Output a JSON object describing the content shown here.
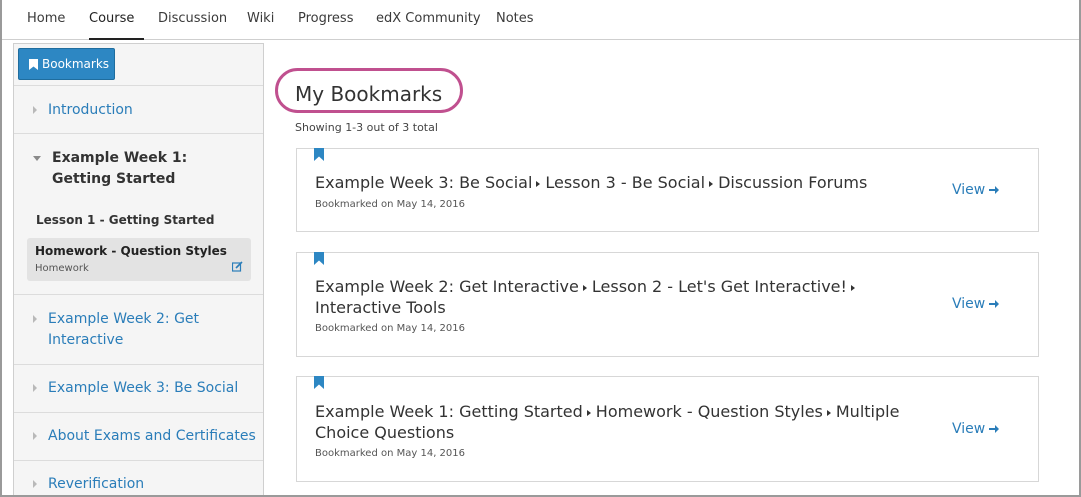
{
  "nav": {
    "tabs": [
      "Home",
      "Course",
      "Discussion",
      "Wiki",
      "Progress",
      "edX Community",
      "Notes"
    ],
    "active": "Course"
  },
  "sidebar": {
    "bookmarks_button": "Bookmarks",
    "sections": [
      {
        "label": "Introduction"
      },
      {
        "label": "Example Week 1: Getting Started"
      },
      {
        "label": "Example Week 2: Get Interactive"
      },
      {
        "label": "Example Week 3: Be Social"
      },
      {
        "label": "About Exams and Certificates"
      },
      {
        "label": "Reverification"
      }
    ],
    "lesson": "Lesson 1 - Getting Started",
    "subsection": {
      "title": "Homework - Question Styles",
      "meta": "Homework"
    }
  },
  "main": {
    "title": "My Bookmarks",
    "showing": "Showing 1-3 out of 3 total",
    "view_label": "View",
    "bookmarks": [
      {
        "path": [
          "Example Week 3: Be Social",
          "Lesson 3 - Be Social",
          "Discussion Forums"
        ],
        "meta": "Bookmarked on May 14, 2016"
      },
      {
        "path": [
          "Example Week 2: Get Interactive",
          "Lesson 2 - Let's Get Interactive!",
          "Interactive Tools"
        ],
        "meta": "Bookmarked on May 14, 2016"
      },
      {
        "path": [
          "Example Week 1: Getting Started",
          "Homework - Question Styles",
          "Multiple Choice Questions"
        ],
        "meta": "Bookmarked on May 14, 2016"
      }
    ]
  },
  "colors": {
    "accent": "#2d87c3",
    "link": "#2a7db9",
    "highlight": "#c0508f"
  }
}
